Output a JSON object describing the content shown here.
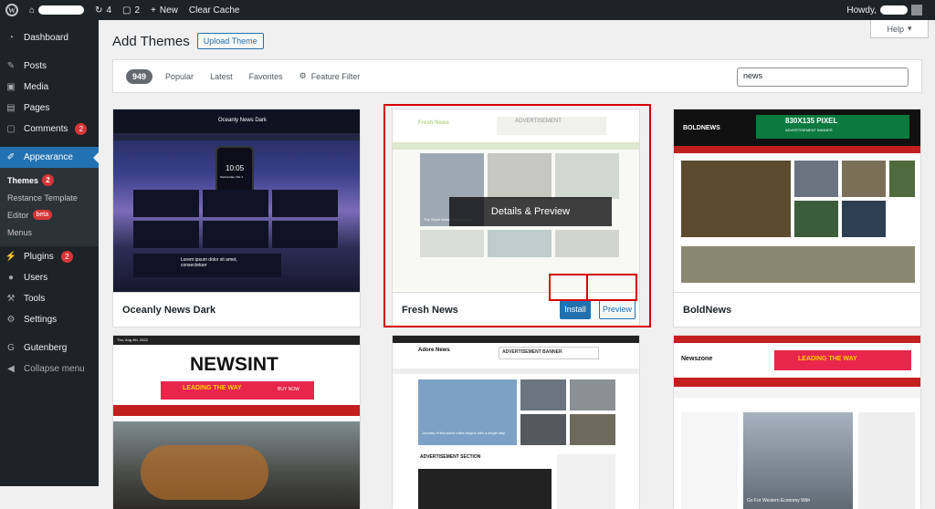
{
  "admin_bar": {
    "updates_count": "4",
    "comments_count": "2",
    "new_label": "New",
    "clear_cache_label": "Clear Cache",
    "howdy_label": "Howdy,"
  },
  "sidebar": {
    "items": [
      {
        "label": "Dashboard",
        "icon": "dashboard-icon"
      },
      {
        "label": "Posts",
        "icon": "pin-icon"
      },
      {
        "label": "Media",
        "icon": "media-icon"
      },
      {
        "label": "Pages",
        "icon": "page-icon"
      },
      {
        "label": "Comments",
        "icon": "comment-icon",
        "count": "2"
      },
      {
        "label": "Appearance",
        "icon": "brush-icon"
      },
      {
        "label": "Plugins",
        "icon": "plugin-icon",
        "count": "2"
      },
      {
        "label": "Users",
        "icon": "user-icon"
      },
      {
        "label": "Tools",
        "icon": "wrench-icon"
      },
      {
        "label": "Settings",
        "icon": "settings-icon"
      },
      {
        "label": "Gutenberg",
        "icon": "gutenberg-icon"
      },
      {
        "label": "Collapse menu",
        "icon": "collapse-icon"
      }
    ],
    "submenu": {
      "themes": "Themes",
      "themes_count": "2",
      "template": "Restance Template",
      "editor": "Editor",
      "editor_badge": "beta",
      "menus": "Menus"
    }
  },
  "header": {
    "title": "Add Themes",
    "upload_label": "Upload Theme",
    "help_label": "Help"
  },
  "filter": {
    "count": "949",
    "tabs": [
      "Popular",
      "Latest",
      "Favorites"
    ],
    "feature_filter": "Feature Filter",
    "search_value": "news"
  },
  "themes": [
    {
      "name": "Oceanly News Dark",
      "screenshot_title": "Oceanly News Dark",
      "screenshot_time": "10:05",
      "screenshot_date": "Wednesday, Mar 4",
      "screenshot_teaser": "Lorem ipsum dolor sit amet, consectetuer"
    },
    {
      "name": "Fresh News",
      "details_label": "Details & Preview",
      "install_label": "Install",
      "preview_label": "Preview",
      "screenshot_logo": "Fresh News",
      "screenshot_ad": "ADVERTISEMENT",
      "screenshot_headline": "The Stock Market Happenings"
    },
    {
      "name": "BoldNews",
      "screenshot_logo": "BOLDNEWS",
      "screenshot_ad": "830X135 PIXEL",
      "screenshot_ad_sub": "ADVERTISEMENT BANNER"
    },
    {
      "name": "NewsInt",
      "screenshot_logo": "NEWSINT",
      "screenshot_banner": "LEADING THE WAY",
      "screenshot_banner_btn": "BUY NOW",
      "screenshot_date": "Thu, Aug 4th, 2022"
    },
    {
      "name": "Adore News",
      "screenshot_logo": "Adore News",
      "screenshot_ad": "ADVERTISEMENT BANNER",
      "screenshot_section": "ADVERTISEMENT SECTION",
      "screenshot_headline": "Journey of thousand miles begins with a single step"
    },
    {
      "name": "Newszone",
      "screenshot_logo": "Newszone",
      "screenshot_banner": "LEADING THE WAY",
      "screenshot_headline": "Go For Western Economy With"
    }
  ],
  "colors": {
    "admin_dark": "#1d2327",
    "wp_blue": "#2271b1",
    "badge_red": "#d63638",
    "highlight_red": "#d60000"
  }
}
